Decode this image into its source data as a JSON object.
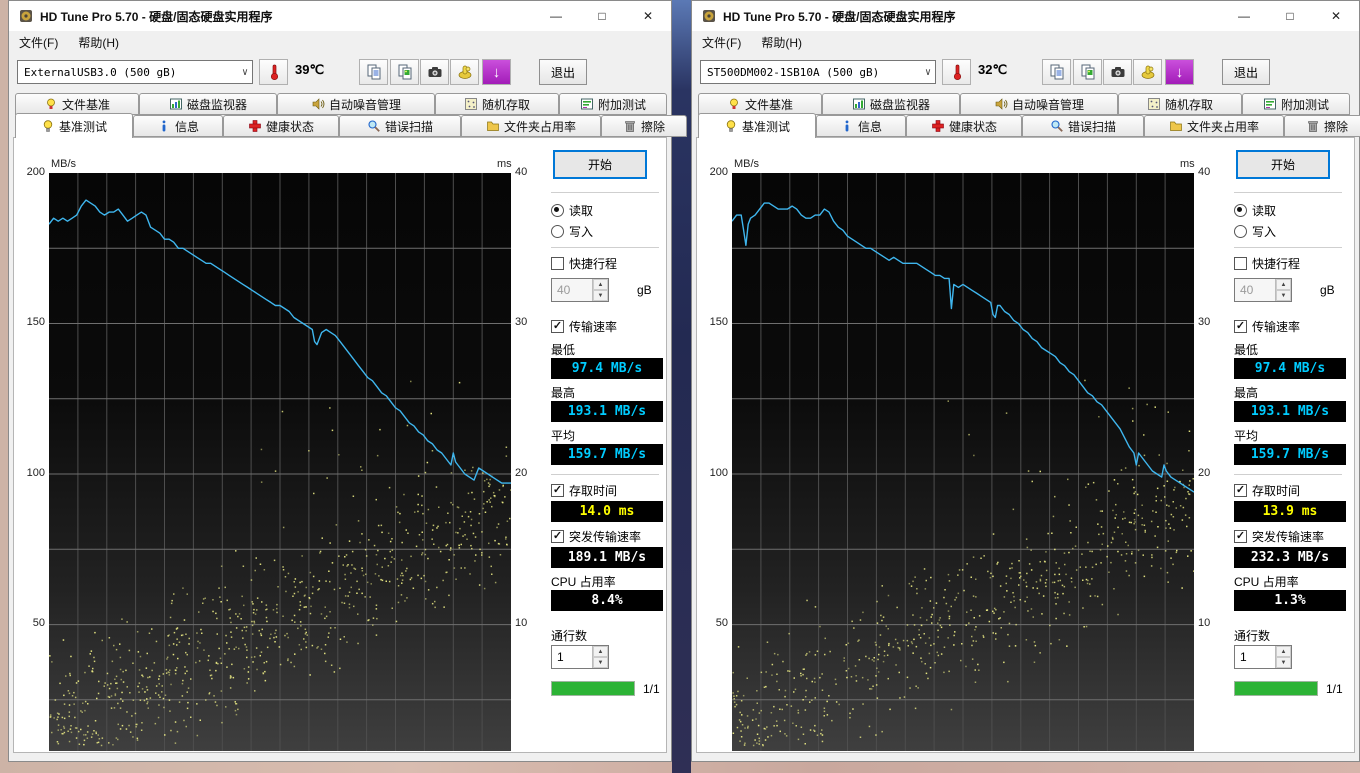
{
  "app": {
    "title": "HD Tune Pro 5.70 - 硬盘/固态硬盘实用程序"
  },
  "menu": {
    "file": "文件(F)",
    "help": "帮助(H)"
  },
  "toolbar": {
    "exit": "退出"
  },
  "icons": {
    "minimize": "—",
    "maximize": "□",
    "close": "✕",
    "chevron_down": "∨",
    "spinner_up": "▲",
    "spinner_down": "▼",
    "check": "✓",
    "save_arrow": "↓"
  },
  "tabs": {
    "row1": [
      "文件基准",
      "磁盘监视器",
      "自动噪音管理",
      "随机存取",
      "附加测试"
    ],
    "row2": [
      "基准测试",
      "信息",
      "健康状态",
      "错误扫描",
      "文件夹占用率",
      "擦除"
    ],
    "active": "基准测试"
  },
  "axes": {
    "left_unit": "MB/s",
    "right_unit": "ms",
    "left_ticks": [
      "200",
      "150",
      "100",
      "50"
    ],
    "right_ticks": [
      "40",
      "30",
      "20",
      "10"
    ]
  },
  "panel": {
    "start": "开始",
    "read": "读取",
    "write": "写入",
    "short_stroke": "快捷行程",
    "short_stroke_value": "40",
    "gb": "gB",
    "transfer_rate": "传输速率",
    "min": "最低",
    "max": "最高",
    "avg": "平均",
    "access_time": "存取时间",
    "burst": "突发传输速率",
    "cpu": "CPU 占用率",
    "passes": "通行数",
    "passes_value": "1",
    "progress": "1/1"
  },
  "windows": [
    {
      "drive": "ExternalUSB3.0 (500 gB)",
      "temperature": "39℃",
      "stats": {
        "min": "97.4 MB/s",
        "max": "193.1 MB/s",
        "avg": "159.7 MB/s",
        "access": "14.0 ms",
        "burst": "189.1 MB/s",
        "cpu": "8.4%"
      }
    },
    {
      "drive": "ST500DM002-1SB10A (500 gB)",
      "temperature": "32℃",
      "stats": {
        "min": "97.4 MB/s",
        "max": "193.1 MB/s",
        "avg": "159.7 MB/s",
        "access": "13.9 ms",
        "burst": "232.3 MB/s",
        "cpu": "1.3%"
      }
    }
  ],
  "chart_data": [
    {
      "type": "line",
      "drive": "ExternalUSB3.0 (500 gB)",
      "y_left": {
        "label": "MB/s",
        "min": 8,
        "max": 200,
        "ticks": [
          200,
          150,
          100,
          50
        ]
      },
      "y_right": {
        "label": "ms",
        "min": 1.6,
        "max": 40,
        "ticks": [
          40,
          30,
          20,
          10
        ]
      },
      "grid": {
        "v_divisions": 16,
        "h_step_mbs": 25
      },
      "series": [
        {
          "name": "传输速率",
          "unit": "MB/s",
          "axis": "left",
          "color": "#3fb6ee",
          "points": [
            [
              0,
              183
            ],
            [
              1,
              185
            ],
            [
              2,
              184
            ],
            [
              3,
              185
            ],
            [
              4,
              184
            ],
            [
              5,
              185
            ],
            [
              6,
              186
            ],
            [
              7,
              189
            ],
            [
              8,
              191
            ],
            [
              9,
              190
            ],
            [
              10,
              189
            ],
            [
              11,
              187
            ],
            [
              12,
              186
            ],
            [
              13,
              187
            ],
            [
              14,
              187
            ],
            [
              15,
              188
            ],
            [
              16,
              186
            ],
            [
              17,
              184
            ],
            [
              18,
              185
            ],
            [
              19,
              186
            ],
            [
              20,
              187
            ],
            [
              21,
              186
            ],
            [
              22,
              182
            ],
            [
              23,
              181
            ],
            [
              24,
              180
            ],
            [
              25,
              178
            ],
            [
              26,
              178
            ],
            [
              27,
              177
            ],
            [
              28,
              175
            ],
            [
              29,
              175
            ],
            [
              30,
              174
            ],
            [
              31,
              173
            ],
            [
              32,
              172
            ],
            [
              33,
              171
            ],
            [
              34,
              170
            ],
            [
              35,
              170
            ],
            [
              36,
              169
            ],
            [
              37,
              168
            ],
            [
              38,
              167
            ],
            [
              39,
              166
            ],
            [
              40,
              165
            ],
            [
              41,
              164
            ],
            [
              42,
              163
            ],
            [
              43,
              162
            ],
            [
              44,
              161
            ],
            [
              45,
              160
            ],
            [
              46,
              159
            ],
            [
              47,
              158
            ],
            [
              48,
              157
            ],
            [
              49,
              156
            ],
            [
              50,
              156
            ],
            [
              51,
              155
            ],
            [
              52,
              154
            ],
            [
              53,
              152
            ],
            [
              54,
              151
            ],
            [
              55,
              150
            ],
            [
              56,
              149
            ],
            [
              57,
              148
            ],
            [
              57.5,
              144
            ],
            [
              58,
              143
            ],
            [
              59,
              147
            ],
            [
              60,
              148
            ],
            [
              61,
              147
            ],
            [
              62,
              146
            ],
            [
              63,
              144
            ],
            [
              64,
              142
            ],
            [
              65,
              140
            ],
            [
              66,
              138
            ],
            [
              67,
              136
            ],
            [
              68,
              134
            ],
            [
              69,
              132
            ],
            [
              70,
              131
            ],
            [
              71,
              129
            ],
            [
              72,
              127
            ],
            [
              73,
              126
            ],
            [
              74,
              124
            ],
            [
              75,
              122
            ],
            [
              76,
              121
            ],
            [
              77,
              119
            ],
            [
              78,
              117
            ],
            [
              79,
              116
            ],
            [
              80,
              114
            ],
            [
              81,
              113
            ],
            [
              82,
              111
            ],
            [
              83,
              110
            ],
            [
              84,
              108
            ],
            [
              85,
              107
            ],
            [
              86,
              105
            ],
            [
              87,
              103
            ],
            [
              87.5,
              107
            ],
            [
              88,
              104
            ],
            [
              89,
              102
            ],
            [
              90,
              100
            ],
            [
              91,
              99
            ],
            [
              92,
              98
            ],
            [
              93,
              102
            ],
            [
              94,
              101
            ],
            [
              95,
              100
            ],
            [
              96,
              99
            ],
            [
              97,
              98
            ],
            [
              98,
              97
            ],
            [
              99,
              97
            ],
            [
              100,
              97
            ]
          ]
        },
        {
          "name": "存取时间",
          "unit": "ms",
          "axis": "right",
          "color": "#eaea84",
          "type": "scatter_band",
          "seed": 20,
          "count": 760,
          "band_base_ms": 3.2,
          "band_slope_ms": 14.5,
          "band_spread_ms": 4.5,
          "outliers": 26
        }
      ],
      "stats": {
        "min_mbs": 97.4,
        "max_mbs": 193.1,
        "avg_mbs": 159.7,
        "access_ms": 14.0,
        "burst_mbs": 189.1,
        "cpu_pct": 8.4
      }
    },
    {
      "type": "line",
      "drive": "ST500DM002-1SB10A (500 gB)",
      "y_left": {
        "label": "MB/s",
        "min": 8,
        "max": 200,
        "ticks": [
          200,
          150,
          100,
          50
        ]
      },
      "y_right": {
        "label": "ms",
        "min": 1.6,
        "max": 40,
        "ticks": [
          40,
          30,
          20,
          10
        ]
      },
      "grid": {
        "v_divisions": 16,
        "h_step_mbs": 25
      },
      "series": [
        {
          "name": "传输速率",
          "unit": "MB/s",
          "axis": "left",
          "color": "#3fb6ee",
          "points": [
            [
              0,
              184
            ],
            [
              1,
              186
            ],
            [
              2,
              186
            ],
            [
              2.5,
              181
            ],
            [
              3,
              176
            ],
            [
              3.5,
              183
            ],
            [
              4,
              185
            ],
            [
              5,
              186
            ],
            [
              6,
              188
            ],
            [
              7,
              190
            ],
            [
              8,
              190
            ],
            [
              9,
              189
            ],
            [
              10,
              188
            ],
            [
              11,
              188
            ],
            [
              12,
              188
            ],
            [
              13,
              189
            ],
            [
              14,
              188
            ],
            [
              15,
              186
            ],
            [
              16,
              185
            ],
            [
              17,
              185
            ],
            [
              18,
              186
            ],
            [
              19,
              186
            ],
            [
              20,
              188
            ],
            [
              21,
              187
            ],
            [
              22,
              184
            ],
            [
              23,
              182
            ],
            [
              24,
              181
            ],
            [
              25,
              179
            ],
            [
              26,
              178
            ],
            [
              27,
              177
            ],
            [
              28,
              176
            ],
            [
              29,
              175
            ],
            [
              30,
              175
            ],
            [
              31,
              174
            ],
            [
              32,
              173
            ],
            [
              33,
              172
            ],
            [
              34,
              171
            ],
            [
              35,
              172
            ],
            [
              36,
              171
            ],
            [
              37,
              170
            ],
            [
              38,
              170
            ],
            [
              39,
              170
            ],
            [
              40,
              170
            ],
            [
              41,
              169
            ],
            [
              42,
              168
            ],
            [
              43,
              167
            ],
            [
              44,
              166
            ],
            [
              45,
              166
            ],
            [
              46,
              165
            ],
            [
              47,
              165
            ],
            [
              47.5,
              155
            ],
            [
              48,
              163
            ],
            [
              49,
              162
            ],
            [
              50,
              163
            ],
            [
              51,
              162
            ],
            [
              52,
              161
            ],
            [
              53,
              160
            ],
            [
              54,
              159
            ],
            [
              55,
              158
            ],
            [
              56,
              157
            ],
            [
              56.5,
              153
            ],
            [
              57,
              152
            ],
            [
              57.5,
              156
            ],
            [
              58,
              156
            ],
            [
              59,
              154
            ],
            [
              60,
              153
            ],
            [
              61,
              151
            ],
            [
              62,
              150
            ],
            [
              63,
              148
            ],
            [
              64,
              147
            ],
            [
              65,
              145
            ],
            [
              66,
              144
            ],
            [
              67,
              142
            ],
            [
              68,
              141
            ],
            [
              69,
              140
            ],
            [
              70,
              139
            ],
            [
              71,
              137
            ],
            [
              72,
              136
            ],
            [
              73,
              134
            ],
            [
              74,
              133
            ],
            [
              75,
              131
            ],
            [
              76,
              129
            ],
            [
              77,
              127
            ],
            [
              78,
              126
            ],
            [
              79,
              124
            ],
            [
              80,
              123
            ],
            [
              81,
              121
            ],
            [
              82,
              119
            ],
            [
              83,
              117
            ],
            [
              84,
              115
            ],
            [
              85,
              112
            ],
            [
              86,
              109
            ],
            [
              87,
              107
            ],
            [
              87.5,
              103
            ],
            [
              88,
              107
            ],
            [
              89,
              105
            ],
            [
              90,
              103
            ],
            [
              91,
              101
            ],
            [
              92,
              100
            ],
            [
              93,
              99
            ],
            [
              93.5,
              103
            ],
            [
              94,
              101
            ],
            [
              95,
              99
            ],
            [
              96,
              98
            ],
            [
              97,
              97
            ],
            [
              98,
              96
            ],
            [
              99,
              95
            ],
            [
              100,
              94
            ]
          ]
        },
        {
          "name": "存取时间",
          "unit": "ms",
          "axis": "right",
          "color": "#eaea84",
          "type": "scatter_band",
          "seed": 77,
          "count": 620,
          "band_base_ms": 3.2,
          "band_slope_ms": 14.5,
          "band_spread_ms": 4.5,
          "outliers": 22
        }
      ],
      "stats": {
        "min_mbs": 97.4,
        "max_mbs": 193.1,
        "avg_mbs": 159.7,
        "access_ms": 13.9,
        "burst_mbs": 232.3,
        "cpu_pct": 1.3
      }
    }
  ],
  "colors": {
    "line_blue": "#3fb6ee",
    "scatter_yellow": "#eaea84",
    "value_cyan": "#00ccff",
    "value_yellow": "#ffff00",
    "value_white": "#ffffff",
    "progress_green": "#2cb335",
    "focus_blue": "#0078d7",
    "grid_v": "#4e4e4e",
    "grid_h": "#6f6f6f"
  }
}
